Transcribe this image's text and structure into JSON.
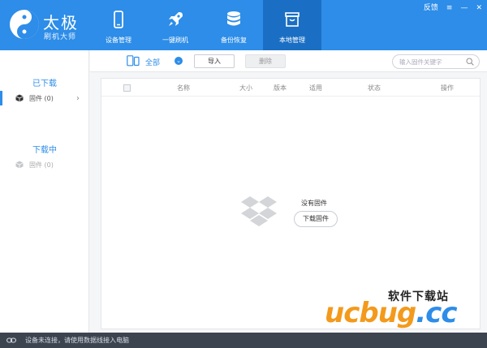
{
  "app": {
    "brand_name": "太极",
    "brand_sub": "刷机大师"
  },
  "nav": {
    "items": [
      {
        "label": "设备管理",
        "icon": "phone-icon"
      },
      {
        "label": "一键刷机",
        "icon": "rocket-icon"
      },
      {
        "label": "备份恢复",
        "icon": "database-icon"
      },
      {
        "label": "本地管理",
        "icon": "storage-box-icon"
      }
    ],
    "active": "本地管理"
  },
  "window_controls": {
    "feedback": "反馈",
    "menu": "≡",
    "minimize": "—",
    "close": "✕"
  },
  "sidebar": {
    "downloaded_heading": "已下载",
    "downloaded_item": "固件 (0)",
    "downloading_heading": "下载中",
    "downloading_item": "固件 (0)"
  },
  "toolbar": {
    "device_filter": "全部",
    "import_label": "导入",
    "delete_label": "删除",
    "search_placeholder": "输入固件关键字"
  },
  "table": {
    "columns": [
      "名称",
      "大小",
      "版本",
      "适用",
      "状态",
      "操作"
    ]
  },
  "empty_state": {
    "message": "没有固件",
    "download_button": "下载固件"
  },
  "watermark": {
    "top_text": "软件下载站",
    "main_text": "ucbug",
    "suffix": ".cc"
  },
  "statusbar": {
    "message": "设备未连接，请使用数据线接入电脑"
  },
  "colors": {
    "accent": "#2d8de8",
    "nav_active": "#1a6fc4",
    "statusbar": "#3c4450",
    "watermark": "#f39a1c"
  }
}
